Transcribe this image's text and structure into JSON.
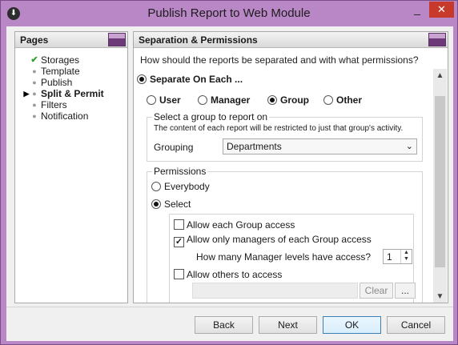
{
  "window": {
    "title": "Publish Report to Web Module"
  },
  "pages": {
    "heading": "Pages",
    "items": [
      {
        "label": "Storages",
        "state": "done"
      },
      {
        "label": "Template",
        "state": "dot"
      },
      {
        "label": "Publish",
        "state": "dot"
      },
      {
        "label": "Split & Permit",
        "state": "current"
      },
      {
        "label": "Filters",
        "state": "dot"
      },
      {
        "label": "Notification",
        "state": "dot"
      }
    ]
  },
  "main": {
    "heading": "Separation & Permissions",
    "question": "How should the reports be separated and with what permissions?",
    "separate_label": "Separate On Each ...",
    "separate_options": [
      "User",
      "Manager",
      "Group",
      "Other"
    ],
    "separate_selected": "Group",
    "group_box": {
      "title": "Select a group to report on",
      "description": "The content of each report will be restricted to just that group's activity.",
      "grouping_label": "Grouping",
      "grouping_value": "Departments"
    },
    "permissions": {
      "title": "Permissions",
      "everybody_label": "Everybody",
      "select_label": "Select",
      "selected": "Select",
      "allow_each_group": {
        "label": "Allow each Group access",
        "checked": false
      },
      "allow_managers": {
        "label": "Allow only managers of each Group access",
        "checked": true
      },
      "manager_levels_label": "How many Manager levels have access?",
      "manager_levels_value": "1",
      "allow_others": {
        "label": "Allow others to access",
        "checked": false
      },
      "clear_label": "Clear",
      "browse_label": "..."
    }
  },
  "footer": {
    "back": "Back",
    "next": "Next",
    "ok": "OK",
    "cancel": "Cancel"
  },
  "colors": {
    "frame": "#b986c6",
    "close": "#c7392b",
    "check": "#2ea02e"
  },
  "icons": {
    "app": "download-circle-icon",
    "minimize": "minimize-icon",
    "close": "close-icon"
  }
}
